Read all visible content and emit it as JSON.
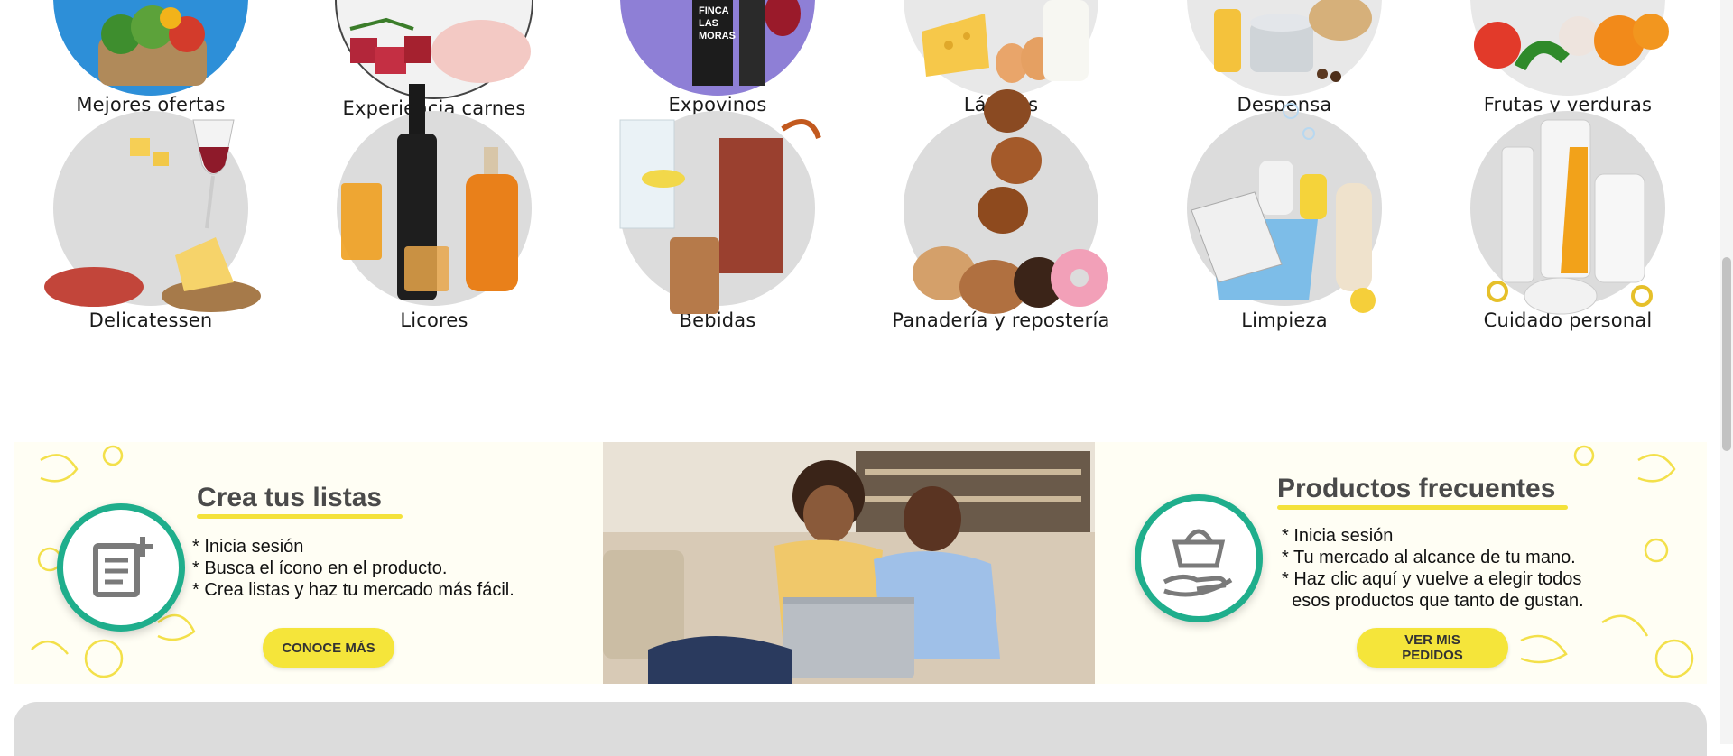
{
  "categories_row1": [
    {
      "label": "Mejores ofertas",
      "icon": "vegetables-basket-icon"
    },
    {
      "label": "Experiencia carnes",
      "icon": "meat-chicken-icon"
    },
    {
      "label": "Expovinos",
      "icon": "wine-bottle-icon"
    },
    {
      "label": "Lácteos",
      "icon": "cheese-eggs-milk-icon"
    },
    {
      "label": "Despensa",
      "icon": "pantry-can-icon"
    },
    {
      "label": "Frutas y verduras",
      "icon": "fruits-icon"
    }
  ],
  "categories_row2": [
    {
      "label": "Delicatessen",
      "icon": "deli-cheese-wine-icon"
    },
    {
      "label": "Licores",
      "icon": "liquor-bottles-icon"
    },
    {
      "label": "Bebidas",
      "icon": "drinks-glasses-icon"
    },
    {
      "label": "Panadería y repostería",
      "icon": "bread-donuts-icon"
    },
    {
      "label": "Limpieza",
      "icon": "cleaning-bucket-icon"
    },
    {
      "label": "Cuidado personal",
      "icon": "personal-care-bottles-icon"
    }
  ],
  "banner": {
    "left": {
      "title": "Crea tus listas",
      "bullets": [
        "* Inicia sesión",
        "* Busca el ícono en el producto.",
        "* Crea listas y haz tu mercado más fácil."
      ],
      "cta": "CONOCE MÁS",
      "icon": "list-add-icon"
    },
    "right": {
      "title": "Productos frecuentes",
      "bullets": [
        "* Inicia sesión",
        "* Tu mercado al alcance de tu mano.",
        "* Haz clic aquí y vuelve a elegir todos",
        "  esos productos que tanto de gustan."
      ],
      "cta": "VER MIS PEDIDOS",
      "icon": "basket-hand-icon"
    },
    "photo": "couple-shopping-laptop-image"
  },
  "colors": {
    "accent_yellow": "#f5e53a",
    "ring_green": "#1fae8c",
    "circle_gray": "#dcdcdc"
  }
}
